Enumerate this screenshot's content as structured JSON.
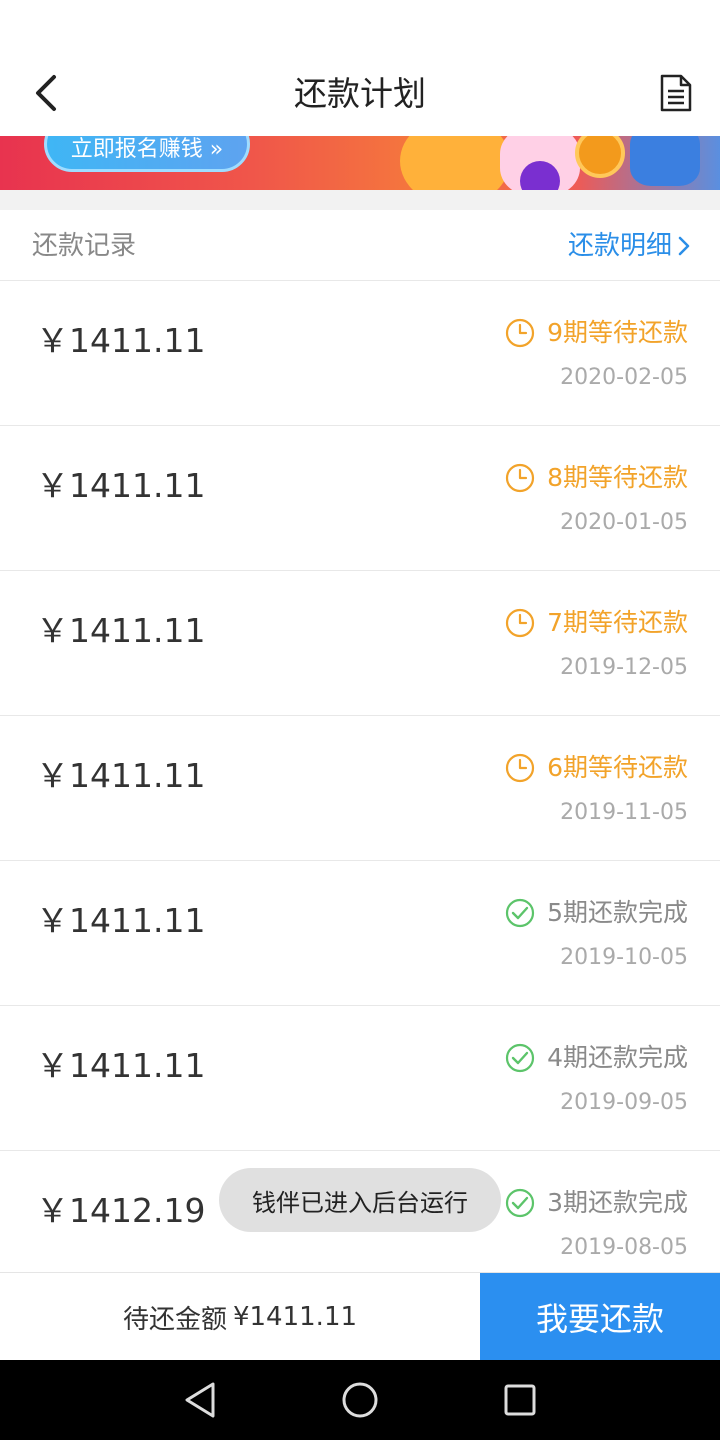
{
  "header": {
    "title": "还款计划",
    "back_icon": "chevron-left-icon",
    "doc_icon": "document-icon"
  },
  "banner": {
    "button_label": "立即报名赚钱 »"
  },
  "section": {
    "title": "还款记录",
    "detail_link": "还款明细"
  },
  "records": [
    {
      "amount": "￥1411.11",
      "status": "9期等待还款",
      "state": "pending",
      "date": "2020-02-05"
    },
    {
      "amount": "￥1411.11",
      "status": "8期等待还款",
      "state": "pending",
      "date": "2020-01-05"
    },
    {
      "amount": "￥1411.11",
      "status": "7期等待还款",
      "state": "pending",
      "date": "2019-12-05"
    },
    {
      "amount": "￥1411.11",
      "status": "6期等待还款",
      "state": "pending",
      "date": "2019-11-05"
    },
    {
      "amount": "￥1411.11",
      "status": "5期还款完成",
      "state": "done",
      "date": "2019-10-05"
    },
    {
      "amount": "￥1411.11",
      "status": "4期还款完成",
      "state": "done",
      "date": "2019-09-05"
    },
    {
      "amount": "￥1412.19",
      "status": "3期还款完成",
      "state": "done",
      "date": "2019-08-05"
    }
  ],
  "toast": "钱伴已进入后台运行",
  "footer": {
    "pending_label": "待还金额",
    "pending_amount": "¥1411.11",
    "pay_button": "我要还款"
  },
  "colors": {
    "accent_blue": "#2b8ff0",
    "pending_orange": "#f2a32a",
    "done_green": "#5cc46a"
  }
}
